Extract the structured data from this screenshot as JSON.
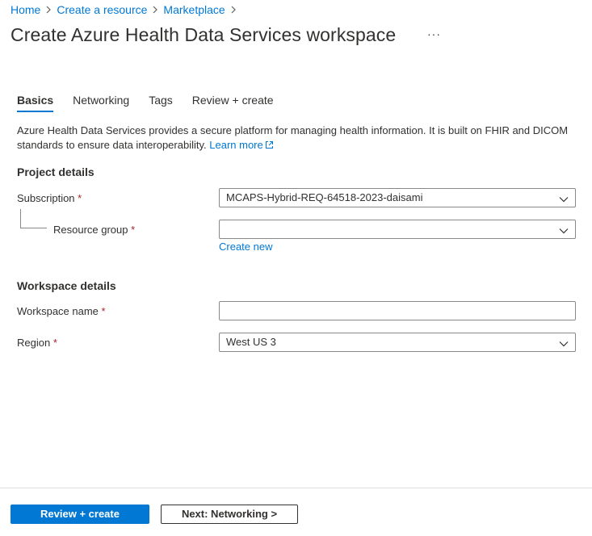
{
  "breadcrumb": {
    "items": [
      "Home",
      "Create a resource",
      "Marketplace"
    ]
  },
  "header": {
    "title": "Create Azure Health Data Services workspace",
    "more_label": "···"
  },
  "tabs": [
    {
      "label": "Basics",
      "active": true
    },
    {
      "label": "Networking",
      "active": false
    },
    {
      "label": "Tags",
      "active": false
    },
    {
      "label": "Review + create",
      "active": false
    }
  ],
  "intro": {
    "text": "Azure Health Data Services provides a secure platform for managing health information. It is built on FHIR and DICOM standards to ensure data interoperability.",
    "learn_more": "Learn more"
  },
  "project_details": {
    "title": "Project details",
    "subscription": {
      "label": "Subscription",
      "required_mark": "*",
      "value": "MCAPS-Hybrid-REQ-64518-2023-daisami"
    },
    "resource_group": {
      "label": "Resource group",
      "required_mark": "*",
      "value": "",
      "create_new": "Create new"
    }
  },
  "workspace_details": {
    "title": "Workspace details",
    "workspace_name": {
      "label": "Workspace name",
      "required_mark": "*",
      "value": ""
    },
    "region": {
      "label": "Region",
      "required_mark": "*",
      "value": "West US 3"
    }
  },
  "footer": {
    "primary_button": "Review + create",
    "secondary_button": "Next: Networking >"
  },
  "colors": {
    "accent": "#0078d4",
    "required": "#a4262c",
    "text": "#323130",
    "border": "#8a8886"
  }
}
